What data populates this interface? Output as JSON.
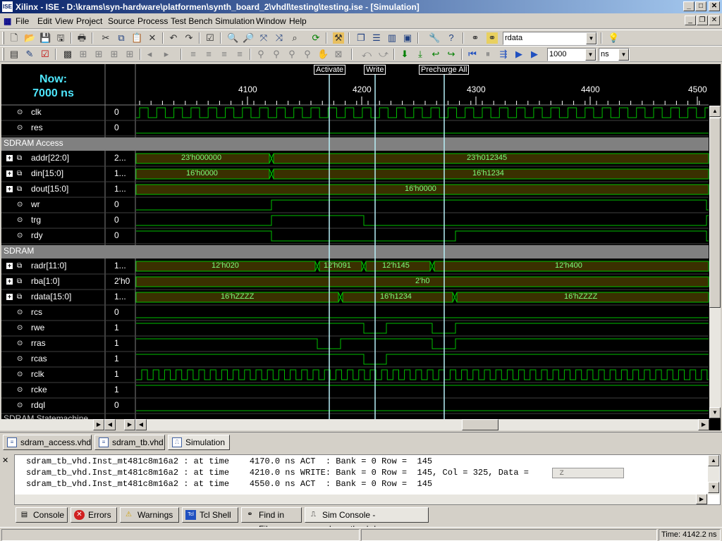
{
  "window": {
    "title": "Xilinx - ISE - D:\\krams\\syn-hardware\\platformen\\synth_board_2\\vhdl\\testing\\testing.ise - [Simulation]",
    "app_icon": "ISE"
  },
  "menu": [
    "File",
    "Edit",
    "View",
    "Project",
    "Source",
    "Process",
    "Test Bench",
    "Simulation",
    "Window",
    "Help"
  ],
  "toolbar": {
    "search_value": "rdata",
    "runtime_value": "1000",
    "unit_value": "ns"
  },
  "wave": {
    "now_label": "Now:",
    "now_time": "7000 ns",
    "ticks": [
      "4100",
      "4200",
      "4300",
      "4400",
      "4500"
    ],
    "markers": [
      "Activate",
      "Write",
      "Precharge All"
    ],
    "signals": [
      {
        "name": "clk",
        "value": "0",
        "kind": "clock"
      },
      {
        "name": "res",
        "value": "0",
        "kind": "low"
      },
      {
        "group": "SDRAM Access"
      },
      {
        "name": "addr[22:0]",
        "value": "2...",
        "kind": "bus",
        "labels": [
          "23'h000000",
          "23'h012345"
        ]
      },
      {
        "name": "din[15:0]",
        "value": "1...",
        "kind": "bus",
        "labels": [
          "16'h0000",
          "16'h1234"
        ]
      },
      {
        "name": "dout[15:0]",
        "value": "1...",
        "kind": "bus",
        "labels": [
          "16'h0000"
        ]
      },
      {
        "name": "wr",
        "value": "0",
        "kind": "bit"
      },
      {
        "name": "trg",
        "value": "0",
        "kind": "bit"
      },
      {
        "name": "rdy",
        "value": "0",
        "kind": "bit"
      },
      {
        "group": "SDRAM"
      },
      {
        "name": "radr[11:0]",
        "value": "1...",
        "kind": "bus",
        "labels": [
          "12'h020",
          "12'h091",
          "12'h145",
          "12'h400"
        ]
      },
      {
        "name": "rba[1:0]",
        "value": "2'h0",
        "kind": "bus",
        "labels": [
          "2'h0"
        ]
      },
      {
        "name": "rdata[15:0]",
        "value": "1...",
        "kind": "bus",
        "labels": [
          "16'hZZZZ",
          "16'h1234",
          "16'hZZZZ"
        ]
      },
      {
        "name": "rcs",
        "value": "0",
        "kind": "low"
      },
      {
        "name": "rwe",
        "value": "1",
        "kind": "bit"
      },
      {
        "name": "rras",
        "value": "1",
        "kind": "bit"
      },
      {
        "name": "rcas",
        "value": "1",
        "kind": "bit"
      },
      {
        "name": "rclk",
        "value": "1",
        "kind": "clock"
      },
      {
        "name": "rcke",
        "value": "1",
        "kind": "high"
      },
      {
        "name": "rdql",
        "value": "0",
        "kind": "low"
      }
    ],
    "partial_group": "SDRAM Statemachine"
  },
  "doc_tabs": [
    "sdram_access.vhd",
    "sdram_tb.vhd",
    "Simulation"
  ],
  "console_lines": [
    "sdram_tb_vhd.Inst_mt481c8m16a2 : at time    4170.0 ns ACT  : Bank = 0 Row =  145",
    "sdram_tb_vhd.Inst_mt481c8m16a2 : at time    4210.0 ns WRITE: Bank = 0 Row =  145, Col = 325, Data =      z",
    "sdram_tb_vhd.Inst_mt481c8m16a2 : at time    4550.0 ns ACT  : Bank = 0 Row =  145"
  ],
  "bottom_tabs": [
    "Console",
    "Errors",
    "Warnings",
    "Tcl Shell",
    "Find in Files",
    "Sim Console - sdram_tb_vhd"
  ],
  "status": {
    "time": "Time: 4142.2 ns"
  },
  "colors": {
    "wave_line": "#00c000",
    "bus_fill": "#3a3000",
    "cursor": "#b8f0f8",
    "group_bg": "#808080"
  }
}
